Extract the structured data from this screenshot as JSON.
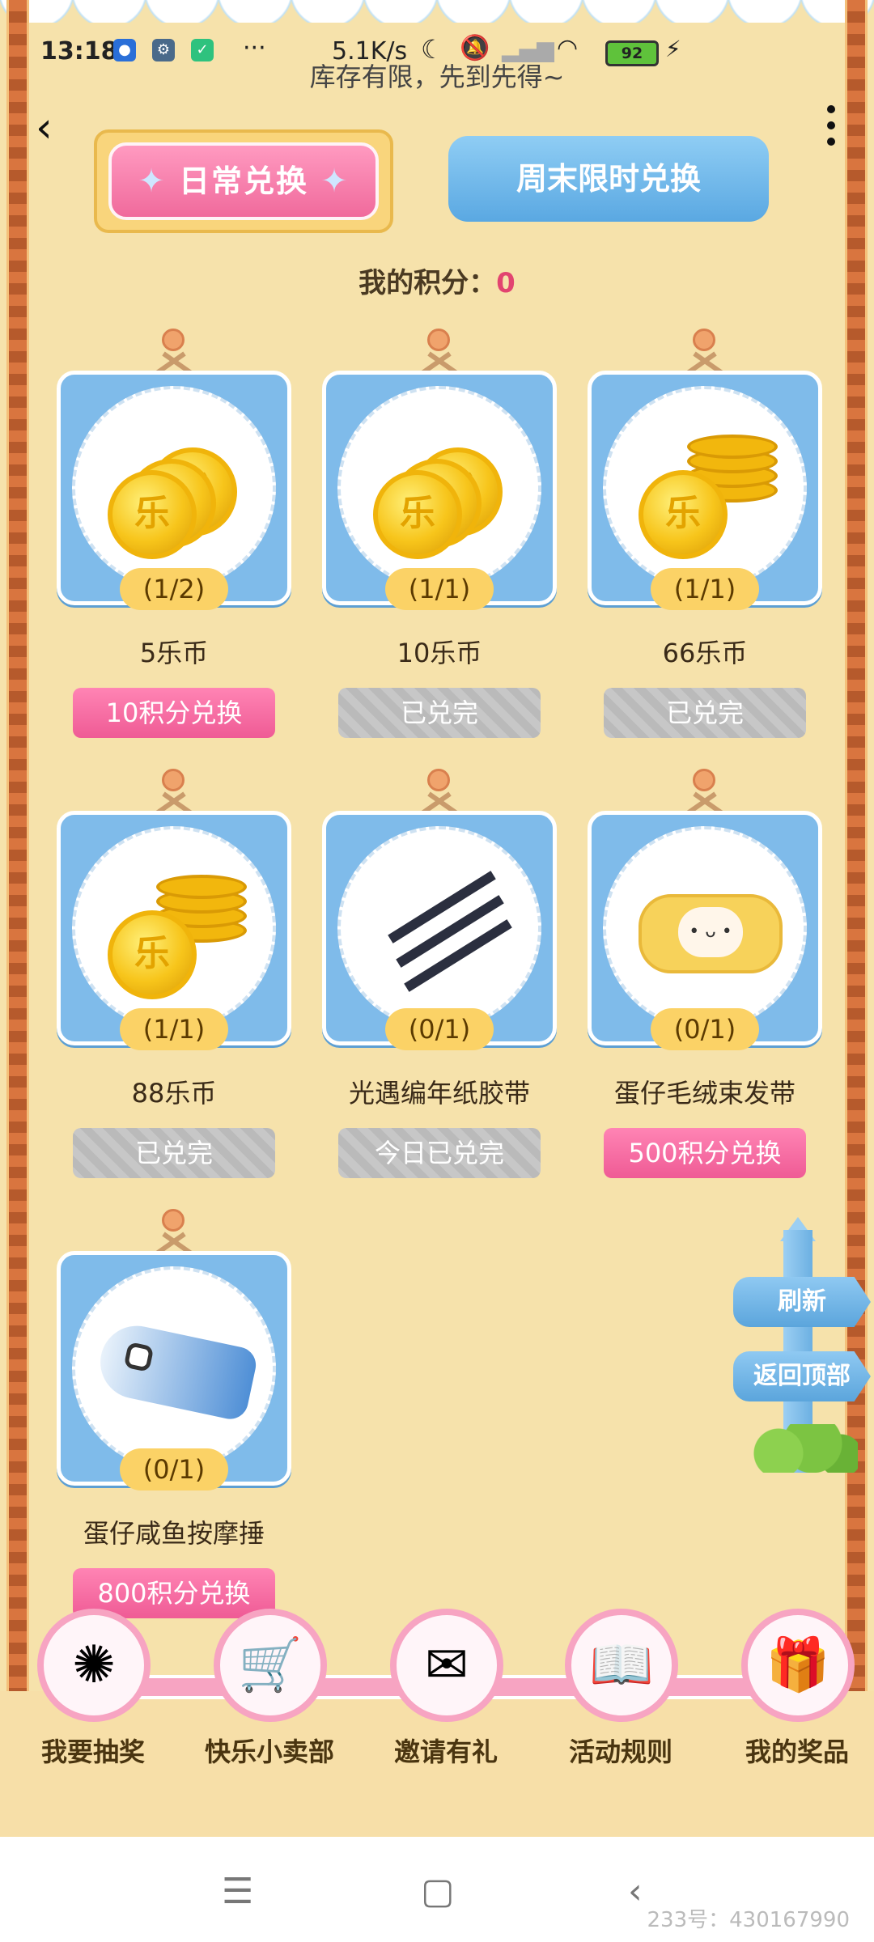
{
  "status_bar": {
    "time": "13:18",
    "speed": "5.1K/s",
    "battery": "92"
  },
  "header": {
    "banner": "库存有限，先到先得~",
    "back_icon": "‹",
    "more_icon": "more-vertical"
  },
  "tabs": {
    "daily": "日常兑换",
    "weekend": "周末限时兑换"
  },
  "points": {
    "label": "我的积分：",
    "value": "0"
  },
  "items": [
    {
      "qty": "(1/2)",
      "name": "5乐币",
      "button": "10积分兑换",
      "state": "active",
      "art": "coins"
    },
    {
      "qty": "(1/1)",
      "name": "10乐币",
      "button": "已兑完",
      "state": "done",
      "art": "coins"
    },
    {
      "qty": "(1/1)",
      "name": "66乐币",
      "button": "已兑完",
      "state": "done",
      "art": "coinstack"
    },
    {
      "qty": "(1/1)",
      "name": "88乐币",
      "button": "已兑完",
      "state": "done",
      "art": "coinstack"
    },
    {
      "qty": "(0/1)",
      "name": "光遇编年纸胶带",
      "button": "今日已兑完",
      "state": "done",
      "art": "tape"
    },
    {
      "qty": "(0/1)",
      "name": "蛋仔毛绒束发带",
      "button": "500积分兑换",
      "state": "active",
      "art": "headband"
    },
    {
      "qty": "(0/1)",
      "name": "蛋仔咸鱼按摩捶",
      "button": "800积分兑换",
      "state": "active",
      "art": "fish"
    }
  ],
  "coin_char": "乐",
  "side_buttons": {
    "refresh": "刷新",
    "top": "返回顶部"
  },
  "bottom_nav": [
    {
      "label": "我要抽奖",
      "icon": "wheel-icon"
    },
    {
      "label": "快乐小卖部",
      "icon": "cart-icon"
    },
    {
      "label": "邀请有礼",
      "icon": "envelope-icon"
    },
    {
      "label": "活动规则",
      "icon": "book-icon"
    },
    {
      "label": "我的奖品",
      "icon": "gift-icon"
    }
  ],
  "watermark": "233号：430167990"
}
